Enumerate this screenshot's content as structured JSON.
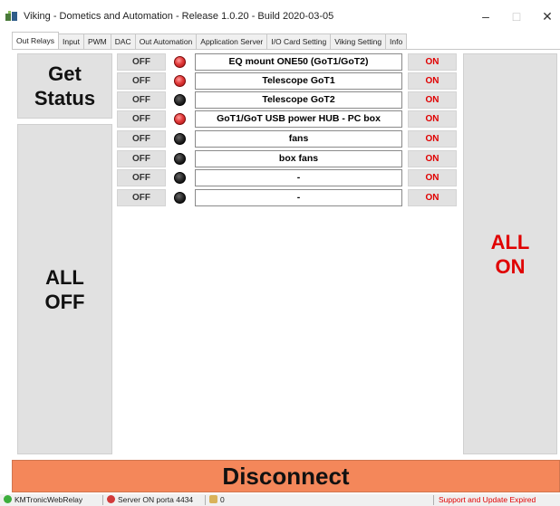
{
  "window": {
    "title": "Viking - Dometics and Automation - Release 1.0.20 - Build 2020-03-05",
    "minimize_label": "–",
    "maximize_label": "□",
    "close_label": "✕",
    "icon": "app-logo-icon"
  },
  "tabs": [
    {
      "label": "Out Relays",
      "active": true
    },
    {
      "label": "Input"
    },
    {
      "label": "PWM"
    },
    {
      "label": "DAC"
    },
    {
      "label": "Out Automation"
    },
    {
      "label": "Application Server"
    },
    {
      "label": "I/O Card Setting"
    },
    {
      "label": "Viking Setting"
    },
    {
      "label": "Info"
    }
  ],
  "controls": {
    "get_status_line1": "Get",
    "get_status_line2": "Status",
    "all_off_line1": "ALL",
    "all_off_line2": "OFF",
    "all_on_line1": "ALL",
    "all_on_line2": "ON",
    "disconnect": "Disconnect"
  },
  "relays": [
    {
      "off": "OFF",
      "on": "ON",
      "name": "EQ mount ONE50 (GoT1/GoT2)",
      "state": "on"
    },
    {
      "off": "OFF",
      "on": "ON",
      "name": "Telescope GoT1",
      "state": "on"
    },
    {
      "off": "OFF",
      "on": "ON",
      "name": "Telescope GoT2",
      "state": "off"
    },
    {
      "off": "OFF",
      "on": "ON",
      "name": "GoT1/GoT USB power HUB - PC box",
      "state": "on"
    },
    {
      "off": "OFF",
      "on": "ON",
      "name": "fans",
      "state": "off"
    },
    {
      "off": "OFF",
      "on": "ON",
      "name": "box fans",
      "state": "off"
    },
    {
      "off": "OFF",
      "on": "ON",
      "name": "-",
      "state": "off"
    },
    {
      "off": "OFF",
      "on": "ON",
      "name": "-",
      "state": "off"
    }
  ],
  "statusbar": {
    "app_name": "KMTronicWebRelay",
    "server": "Server ON porta 4434",
    "users": "0",
    "support": "Support and Update Expired"
  },
  "colors": {
    "on_text": "#e00000",
    "led_on": "#e23b3b",
    "led_off": "#222222",
    "disconnect_bg": "#f4875a",
    "button_bg": "#e1e1e1"
  }
}
